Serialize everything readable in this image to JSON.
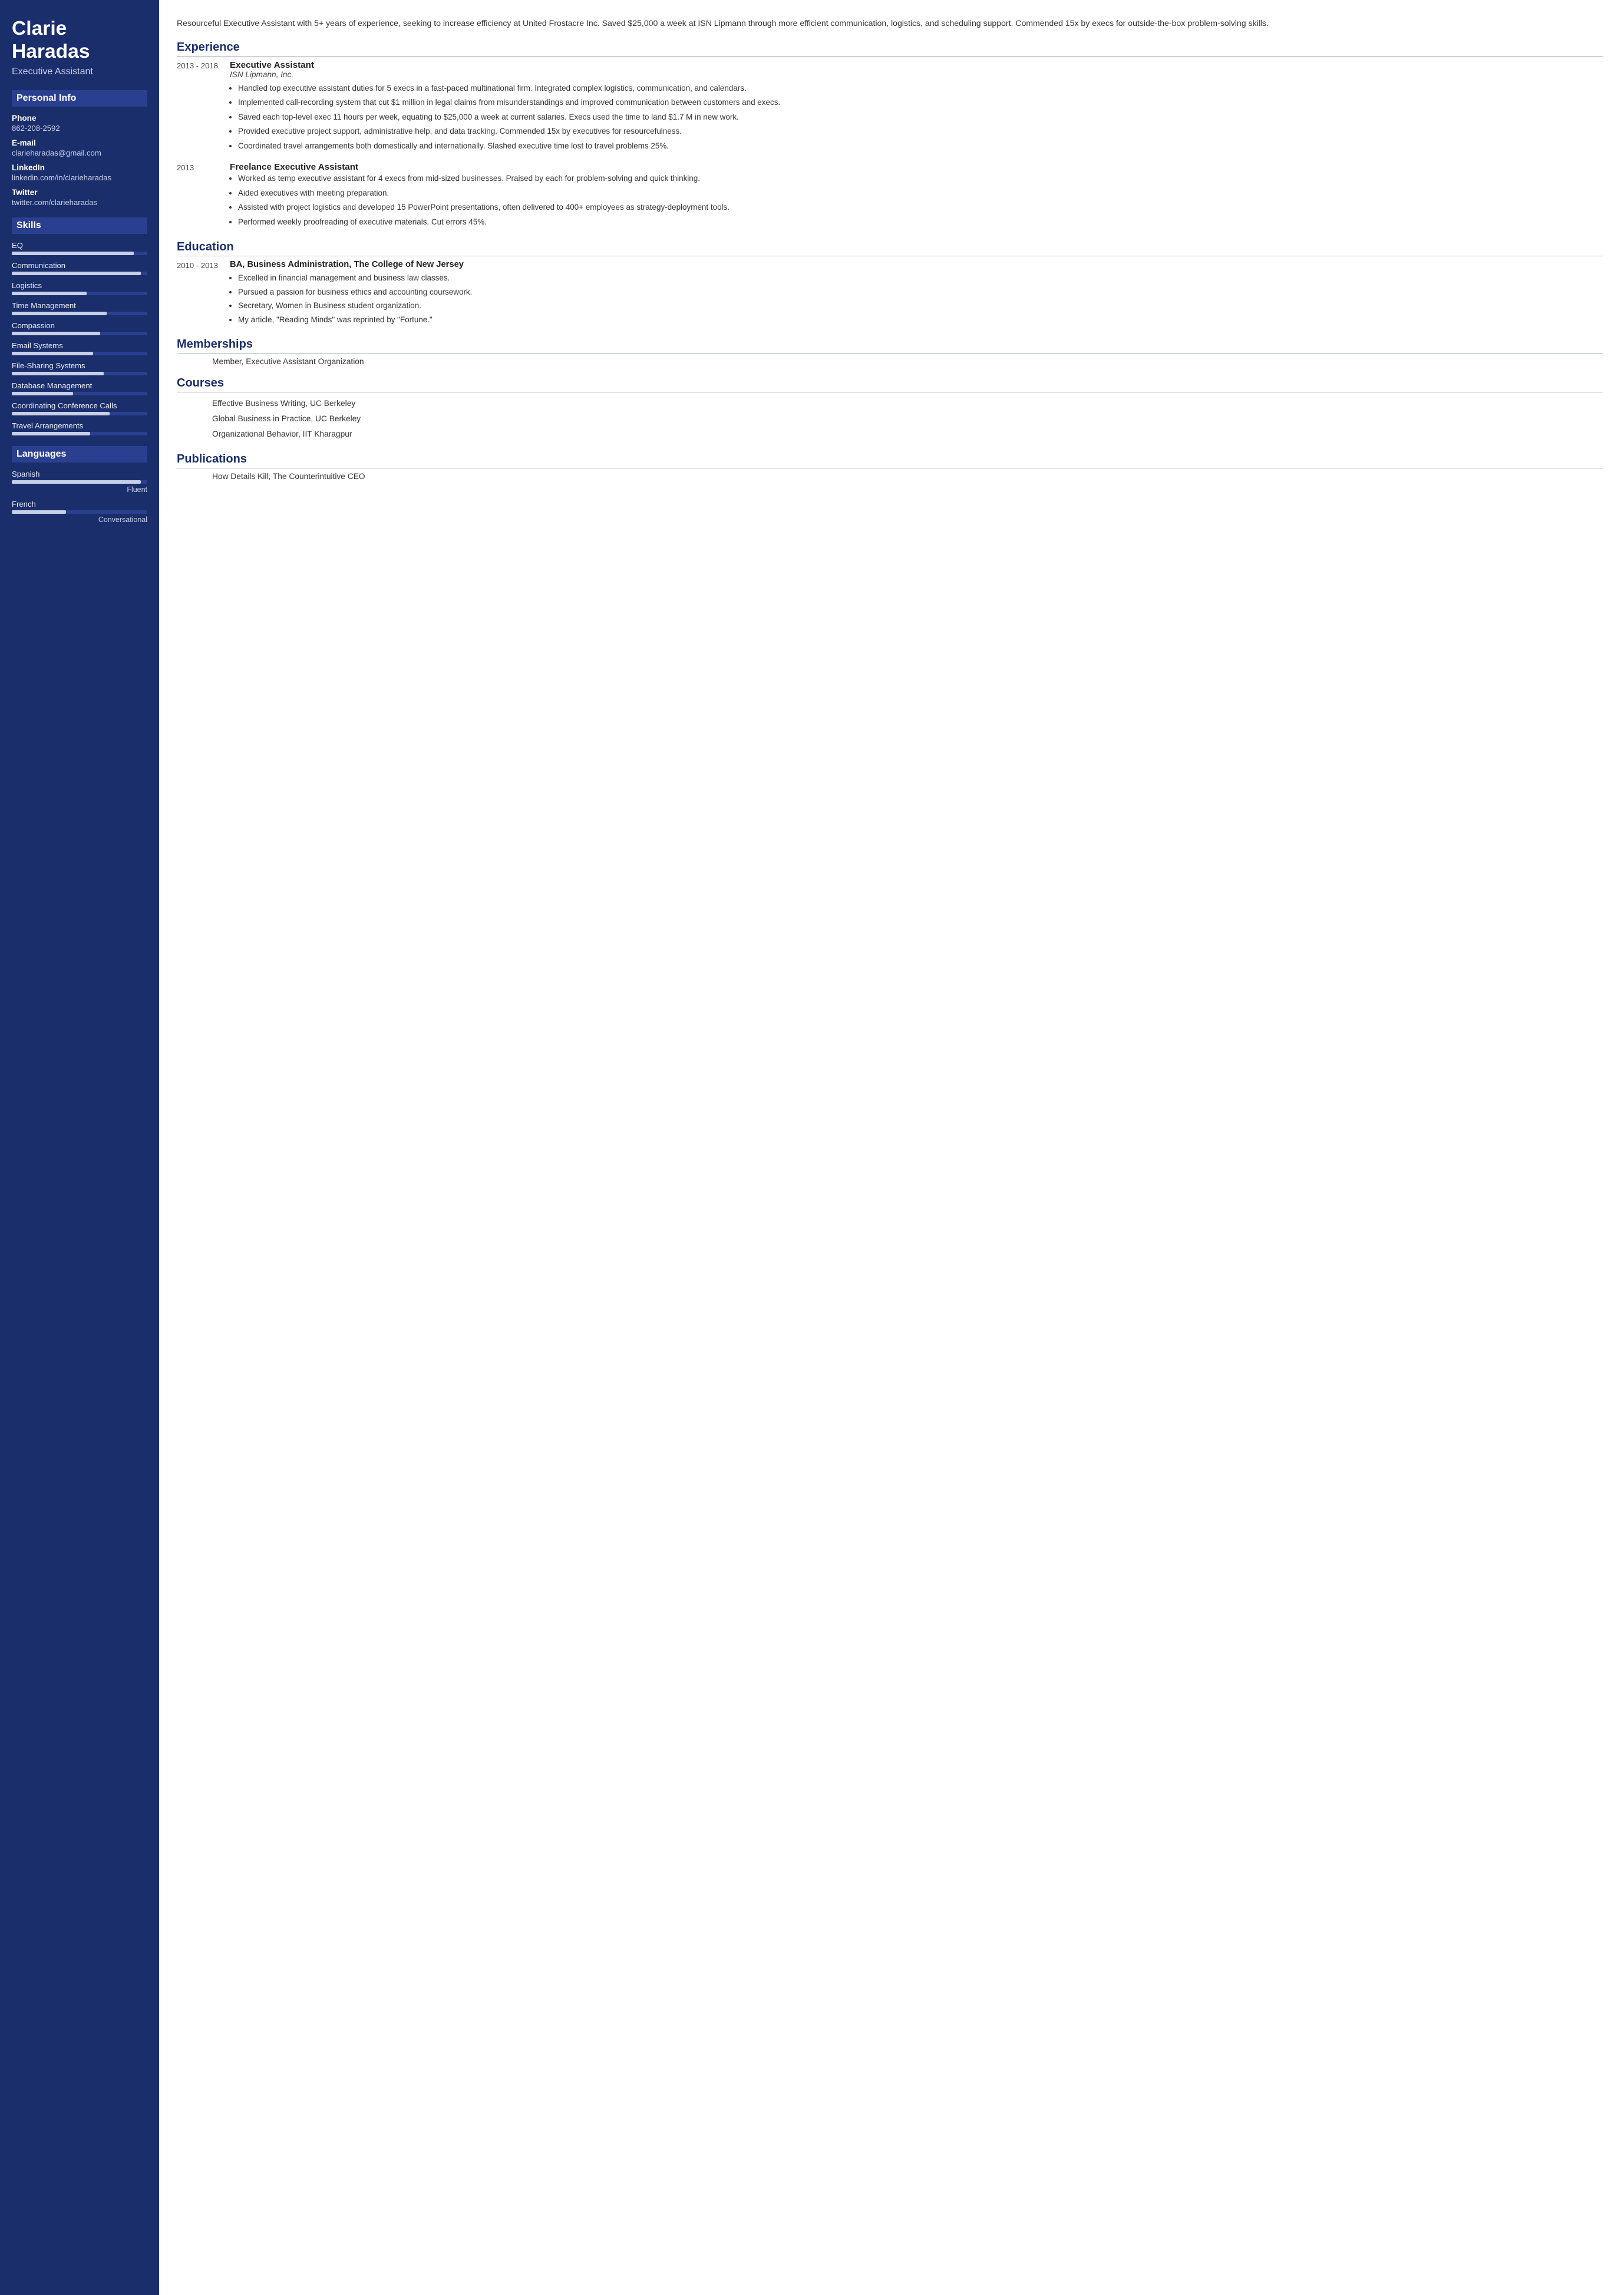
{
  "sidebar": {
    "name": "Clarie Haradas",
    "job_title": "Executive Assistant",
    "personal_info_label": "Personal Info",
    "phone_label": "Phone",
    "phone_value": "862-208-2592",
    "email_label": "E-mail",
    "email_value": "clarieharadas@gmail.com",
    "linkedin_label": "LinkedIn",
    "linkedin_value": "linkedin.com/in/clarieharadas",
    "twitter_label": "Twitter",
    "twitter_value": "twitter.com/clarieharadas",
    "skills_label": "Skills",
    "skills": [
      {
        "name": "EQ",
        "pct": 90
      },
      {
        "name": "Communication",
        "pct": 95
      },
      {
        "name": "Logistics",
        "pct": 55
      },
      {
        "name": "Time Management",
        "pct": 70
      },
      {
        "name": "Compassion",
        "pct": 65
      },
      {
        "name": "Email Systems",
        "pct": 60
      },
      {
        "name": "File-Sharing Systems",
        "pct": 68
      },
      {
        "name": "Database Management",
        "pct": 45
      },
      {
        "name": "Coordinating Conference Calls",
        "pct": 72
      },
      {
        "name": "Travel Arrangements",
        "pct": 58
      }
    ],
    "languages_label": "Languages",
    "languages": [
      {
        "name": "Spanish",
        "pct": 95,
        "level": "Fluent"
      },
      {
        "name": "French",
        "pct": 40,
        "level": "Conversational"
      }
    ]
  },
  "main": {
    "summary": "Resourceful Executive Assistant with 5+ years of experience, seeking to increase efficiency at United Frostacre Inc. Saved $25,000 a week at ISN Lipmann through more efficient communication, logistics, and scheduling support. Commended 15x by execs for outside-the-box problem-solving skills.",
    "experience_title": "Experience",
    "experience": [
      {
        "date": "2013 - 2018",
        "title": "Executive Assistant",
        "company": "ISN Lipmann, Inc.",
        "bullets": [
          "Handled top executive assistant duties for 5 execs in a fast-paced multinational firm. Integrated complex logistics, communication, and calendars.",
          "Implemented call-recording system that cut $1 million in legal claims from misunderstandings and improved communication between customers and execs.",
          "Saved each top-level exec 11 hours per week, equating to $25,000 a week at current salaries. Execs used the time to land $1.7 M in new work.",
          "Provided executive project support, administrative help, and data tracking. Commended 15x by executives for resourcefulness.",
          "Coordinated travel arrangements both domestically and internationally. Slashed executive time lost to travel problems 25%."
        ]
      },
      {
        "date": "2013",
        "title": "Freelance Executive Assistant",
        "company": "",
        "bullets": [
          "Worked as temp executive assistant for 4 execs from mid-sized businesses. Praised by each for problem-solving and quick thinking.",
          "Aided executives with meeting preparation.",
          "Assisted with project logistics and developed 15 PowerPoint presentations, often delivered to 400+ employees as strategy-deployment tools.",
          "Performed weekly proofreading of executive materials. Cut errors 45%."
        ]
      }
    ],
    "education_title": "Education",
    "education": [
      {
        "date": "2010 - 2013",
        "degree": "BA, Business Administration, The College of New Jersey",
        "bullets": [
          "Excelled in financial management and business law classes.",
          "Pursued a passion for business ethics and accounting coursework.",
          "Secretary, Women in Business student organization.",
          "My article, \"Reading Minds\" was reprinted by \"Fortune.\""
        ]
      }
    ],
    "memberships_title": "Memberships",
    "memberships": [
      "Member, Executive Assistant Organization"
    ],
    "courses_title": "Courses",
    "courses": [
      "Effective Business Writing, UC Berkeley",
      "Global Business in Practice, UC Berkeley",
      "Organizational Behavior, IIT Kharagpur"
    ],
    "publications_title": "Publications",
    "publications": [
      "How Details Kill, The Counterintuitive CEO"
    ]
  }
}
